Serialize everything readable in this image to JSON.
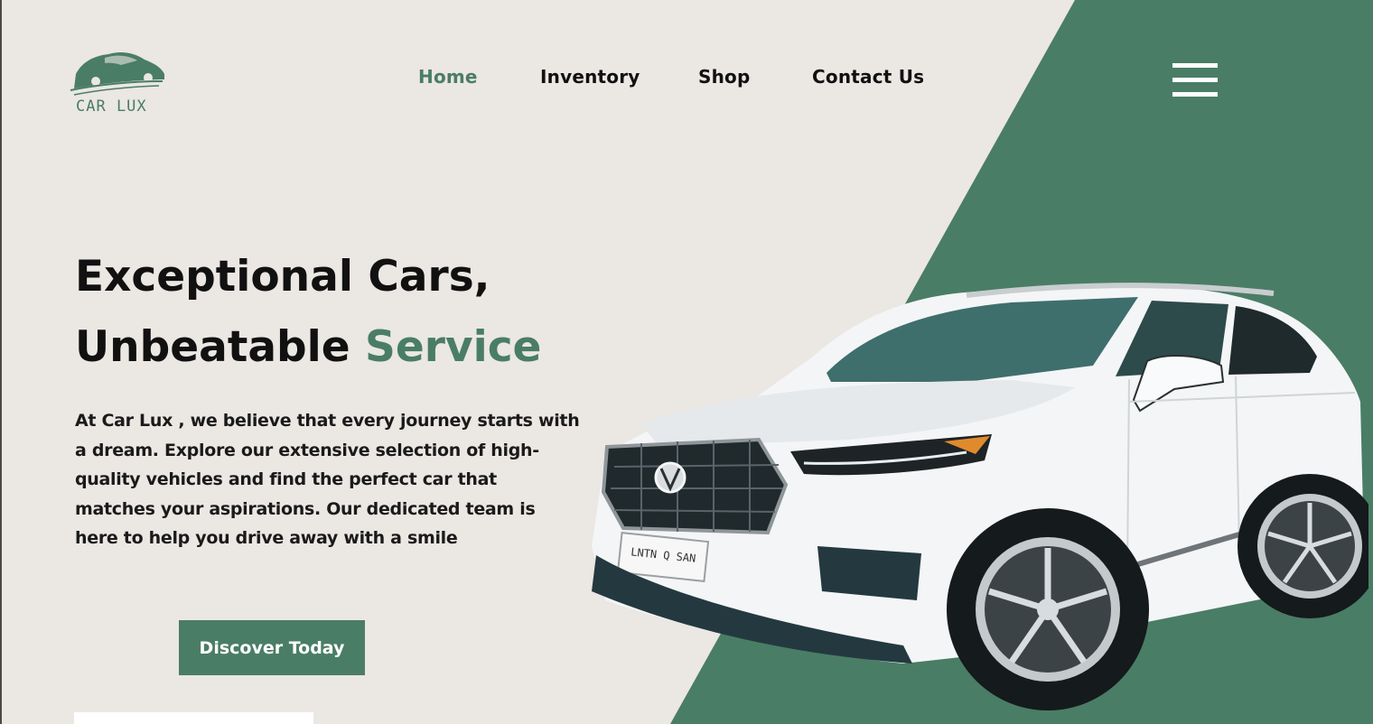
{
  "brand": {
    "name": "CAR LUX",
    "logo_icon": "car-logo-icon"
  },
  "nav": {
    "items": [
      {
        "label": "Home",
        "active": true
      },
      {
        "label": "Inventory",
        "active": false
      },
      {
        "label": "Shop",
        "active": false
      },
      {
        "label": "Contact Us",
        "active": false
      }
    ],
    "menu_icon": "hamburger-menu-icon"
  },
  "hero": {
    "headline_line1": "Exceptional Cars,",
    "headline_line2_plain": "Unbeatable ",
    "headline_line2_accent": "Service",
    "description": "At Car Lux , we believe that every journey starts with a dream. Explore our extensive selection of high-quality vehicles and find the perfect car that matches your aspirations. Our dedicated team is here to help you drive away with a smile",
    "cta_label": "Discover Today"
  },
  "car_image": {
    "plate_text": "LNTN Q SAN"
  },
  "colors": {
    "accent": "#4a7d66",
    "background": "#ebe7e3",
    "panel": "#4a7d66",
    "text": "#111111"
  }
}
